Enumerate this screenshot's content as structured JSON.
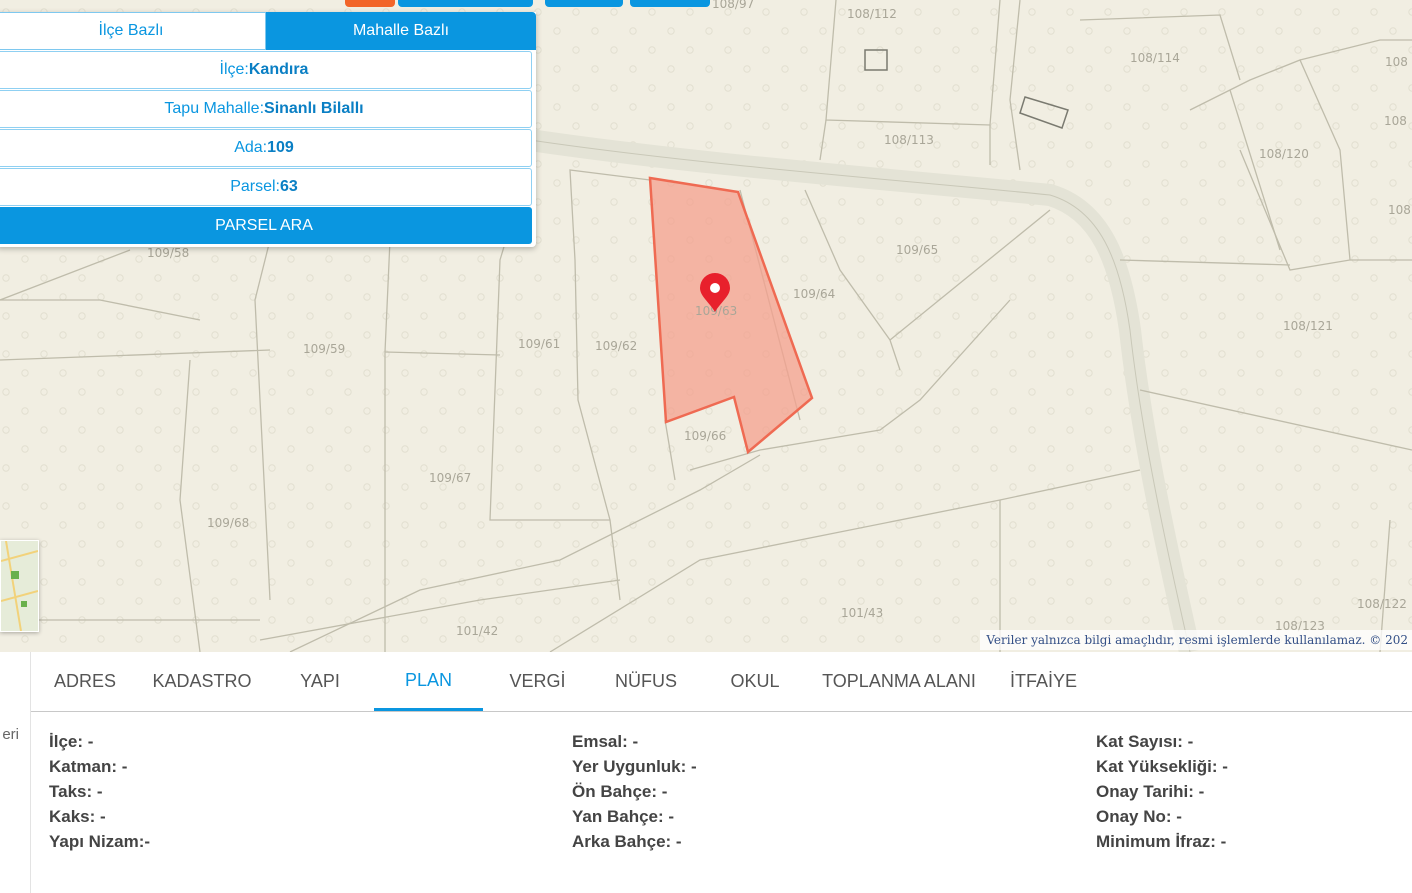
{
  "search_panel": {
    "tabs": [
      {
        "label": "İlçe Bazlı",
        "active": false
      },
      {
        "label": "Mahalle Bazlı",
        "active": true
      }
    ],
    "fields": [
      {
        "label": "İlçe:",
        "value": "Kandıra"
      },
      {
        "label": "Tapu Mahalle:",
        "value": "Sinanlı Bilallı"
      },
      {
        "label": "Ada:",
        "value": "109"
      },
      {
        "label": "Parsel:",
        "value": "63"
      }
    ],
    "search_button": "PARSEL ARA"
  },
  "map": {
    "parcel_labels": [
      "108/97",
      "108/112",
      "108/114",
      "108/113",
      "108/120",
      "109/58",
      "109/65",
      "109/64",
      "109/59",
      "109/61",
      "109/62",
      "109/63",
      "108/121",
      "109/66",
      "109/67",
      "109/68",
      "101/43",
      "101/42",
      "108/122",
      "108/123",
      "108",
      "108",
      "108"
    ],
    "attribution": "Veriler yalnızca bilgi amaçlıdır, resmi işlemlerde kullanılamaz. © 202",
    "marker_icon": "map-pin-icon",
    "highlight_color": "#f4a08e"
  },
  "side_strip_text": "eri",
  "info_tabs": [
    {
      "label": "ADRES",
      "active": false
    },
    {
      "label": "KADASTRO",
      "active": false
    },
    {
      "label": "YAPI",
      "active": false
    },
    {
      "label": "PLAN",
      "active": true
    },
    {
      "label": "VERGİ",
      "active": false
    },
    {
      "label": "NÜFUS",
      "active": false
    },
    {
      "label": "OKUL",
      "active": false
    },
    {
      "label": "TOPLANMA ALANI",
      "active": false
    },
    {
      "label": "İTFAİYE",
      "active": false
    }
  ],
  "plan_info": {
    "col1": [
      "İlçe: -",
      "Katman: -",
      "Taks: -",
      "Kaks: -",
      "Yapı Nizam:-"
    ],
    "col2": [
      "Emsal: -",
      "Yer Uygunluk: -",
      "Ön Bahçe: -",
      "Yan Bahçe: -",
      "Arka Bahçe: -"
    ],
    "col3": [
      "Kat Sayısı: -",
      "Kat Yüksekliği: -",
      "Onay Tarihi: -",
      "Onay No: -",
      "Minimum İfraz: -"
    ]
  },
  "colors": {
    "accent": "#0a96e0",
    "orange": "#f26529",
    "map_bg": "#f1eee2",
    "parcel_fill": "#f4a08e",
    "parcel_stroke": "#ef6a52"
  }
}
